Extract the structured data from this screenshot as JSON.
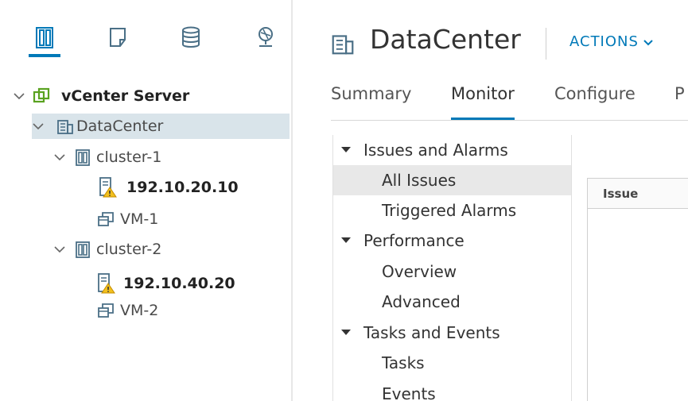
{
  "navigator": {
    "tabs": [
      {
        "icon": "hosts-and-clusters-icon",
        "active": true
      },
      {
        "icon": "vms-and-templates-icon",
        "active": false
      },
      {
        "icon": "storage-icon",
        "active": false
      },
      {
        "icon": "networking-icon",
        "active": false
      }
    ],
    "tree": [
      {
        "label": "vCenter Server",
        "icon": "vcenter-icon",
        "expanded": true
      },
      {
        "label": "DataCenter",
        "icon": "datacenter-icon",
        "expanded": true,
        "selected": true
      },
      {
        "label": "cluster-1",
        "icon": "cluster-icon",
        "expanded": true
      },
      {
        "label": "192.10.20.10",
        "icon": "host-warning-icon"
      },
      {
        "label": "VM-1",
        "icon": "vm-icon"
      },
      {
        "label": "cluster-2",
        "icon": "cluster-icon",
        "expanded": true
      },
      {
        "label": "192.10.40.20",
        "icon": "host-warning-icon"
      },
      {
        "label": "VM-2",
        "icon": "vm-icon"
      }
    ]
  },
  "header": {
    "title": "DataCenter",
    "actions_label": "ACTIONS"
  },
  "tabs": [
    {
      "label": "Summary",
      "active": false
    },
    {
      "label": "Monitor",
      "active": true
    },
    {
      "label": "Configure",
      "active": false
    },
    {
      "label": "P",
      "active": false
    }
  ],
  "monitor_menu": {
    "groups": [
      {
        "label": "Issues and Alarms",
        "items": [
          "All Issues",
          "Triggered Alarms"
        ]
      },
      {
        "label": "Performance",
        "items": [
          "Overview",
          "Advanced"
        ]
      },
      {
        "label": "Tasks and Events",
        "items": [
          "Tasks",
          "Events"
        ]
      }
    ],
    "selected": "All Issues"
  },
  "grid": {
    "columns": [
      "Issue"
    ]
  },
  "colors": {
    "accent": "#0079b8",
    "selected_tree_bg": "#d9e4ea",
    "vcenter_green": "#5aa220",
    "warning_yellow": "#f2c01e"
  }
}
